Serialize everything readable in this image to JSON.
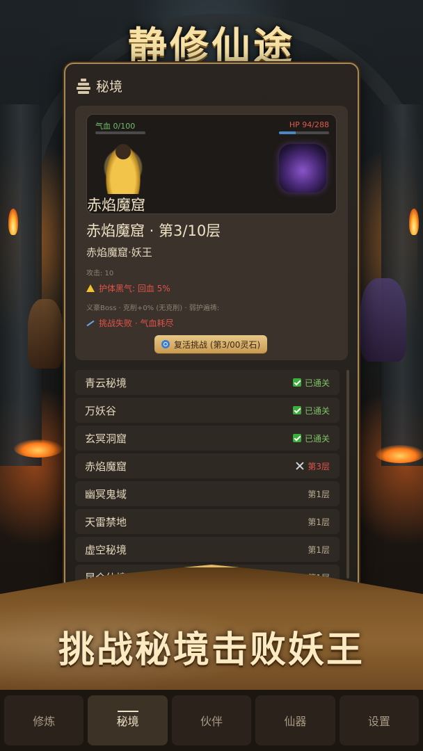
{
  "header": {
    "title": "静修仙途"
  },
  "panel": {
    "icon": "pagoda-icon",
    "title": "秘境",
    "battle": {
      "player_hp": "气血 0/100",
      "player_hp_fraction": 0,
      "enemy_hp": "HP 94/288",
      "enemy_hp_fraction": 0.33,
      "scene_name": "赤焰魔窟"
    },
    "floor_title": "赤焰魔窟 · 第3/10层",
    "boss_name": "赤焰魔窟·妖王",
    "attack": "攻击: 10",
    "buff": "护体黑气: 回血 5%",
    "info": "义豪Boss · 克削+0% (无克削) · 弱护遍祷:",
    "fail": "挑战失败 · 气血耗尽",
    "revive_button": "复活挑战 (第3/00灵石)"
  },
  "dungeons": [
    {
      "name": "青云秘境",
      "status": "已通关",
      "state": "done"
    },
    {
      "name": "万妖谷",
      "status": "已通关",
      "state": "done"
    },
    {
      "name": "玄冥洞窟",
      "status": "已通关",
      "state": "done"
    },
    {
      "name": "赤焰魔窟",
      "status": "第3层",
      "state": "current"
    },
    {
      "name": "幽冥鬼域",
      "status": "第1层",
      "state": "locked"
    },
    {
      "name": "天雷禁地",
      "status": "第1层",
      "state": "locked"
    },
    {
      "name": "虚空秘境",
      "status": "第1层",
      "state": "locked"
    },
    {
      "name": "昆仑仙境",
      "status": "第1层",
      "state": "locked"
    }
  ],
  "banner": {
    "text": "挑战秘境击败妖王"
  },
  "tabs": [
    {
      "label": "修炼",
      "active": false
    },
    {
      "label": "秘境",
      "active": true
    },
    {
      "label": "伙伴",
      "active": false
    },
    {
      "label": "仙器",
      "active": false
    },
    {
      "label": "设置",
      "active": false
    }
  ],
  "colors": {
    "accent_gold": "#e1b865",
    "hp_green": "#6fbf6a",
    "hp_red": "#e05a4a",
    "enemy_bar": "#4a86c8"
  }
}
